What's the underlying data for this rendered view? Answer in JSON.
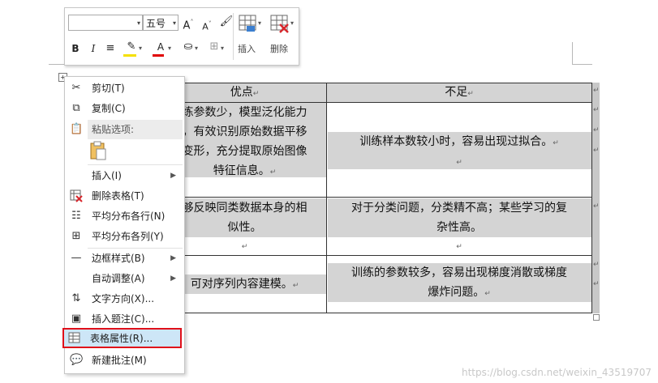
{
  "mini_toolbar": {
    "font_name": "",
    "font_size": "五号",
    "grow_font": "A",
    "shrink_font": "A",
    "bold": "B",
    "italic": "I",
    "font_color": "A",
    "insert_label": "插入",
    "delete_label": "删除",
    "colors": {
      "highlight": "#f5e000",
      "font_color": "#e00000"
    }
  },
  "table": {
    "headers": [
      "优点",
      "不足"
    ],
    "rows": [
      {
        "left_lines": [
          "练参数少，模型泛化能力",
          "，有效识别原始数据平移",
          "变形，充分提取原始图像",
          "特征信息。"
        ],
        "right_lines": [
          "训练样本数较小时，容易出现过拟合。"
        ]
      },
      {
        "left_lines": [
          "够反映同类数据本身的相",
          "似性。"
        ],
        "right_lines": [
          "对于分类问题，分类精不高；某些学习的复",
          "杂性高。"
        ]
      },
      {
        "left_lines": [
          "可对序列内容建模。"
        ],
        "right_lines": [
          "训练的参数较多，容易出现梯度消散或梯度",
          "爆炸问题。"
        ]
      }
    ],
    "para_mark": "↵"
  },
  "context_menu": {
    "items": [
      {
        "icon": "scissors-icon",
        "label": "剪切(T)"
      },
      {
        "icon": "copy-icon",
        "label": "复制(C)"
      },
      {
        "icon": "paste-icon",
        "label": "粘贴选项:"
      },
      {
        "icon": "",
        "label": "插入(I)",
        "submenu": true
      },
      {
        "icon": "delete-table-icon",
        "label": "删除表格(T)"
      },
      {
        "icon": "distribute-rows-icon",
        "label": "平均分布各行(N)"
      },
      {
        "icon": "distribute-columns-icon",
        "label": "平均分布各列(Y)"
      },
      {
        "icon": "border-style-icon",
        "label": "边框样式(B)",
        "submenu": true
      },
      {
        "icon": "",
        "label": "自动调整(A)",
        "submenu": true
      },
      {
        "icon": "text-direction-icon",
        "label": "文字方向(X)..."
      },
      {
        "icon": "insert-caption-icon",
        "label": "插入题注(C)..."
      },
      {
        "icon": "table-properties-icon",
        "label": "表格属性(R)..."
      },
      {
        "icon": "new-comment-icon",
        "label": "新建批注(M)"
      }
    ],
    "highlight_color": "#e0101a"
  },
  "watermark": "https://blog.csdn.net/weixin_43519707"
}
